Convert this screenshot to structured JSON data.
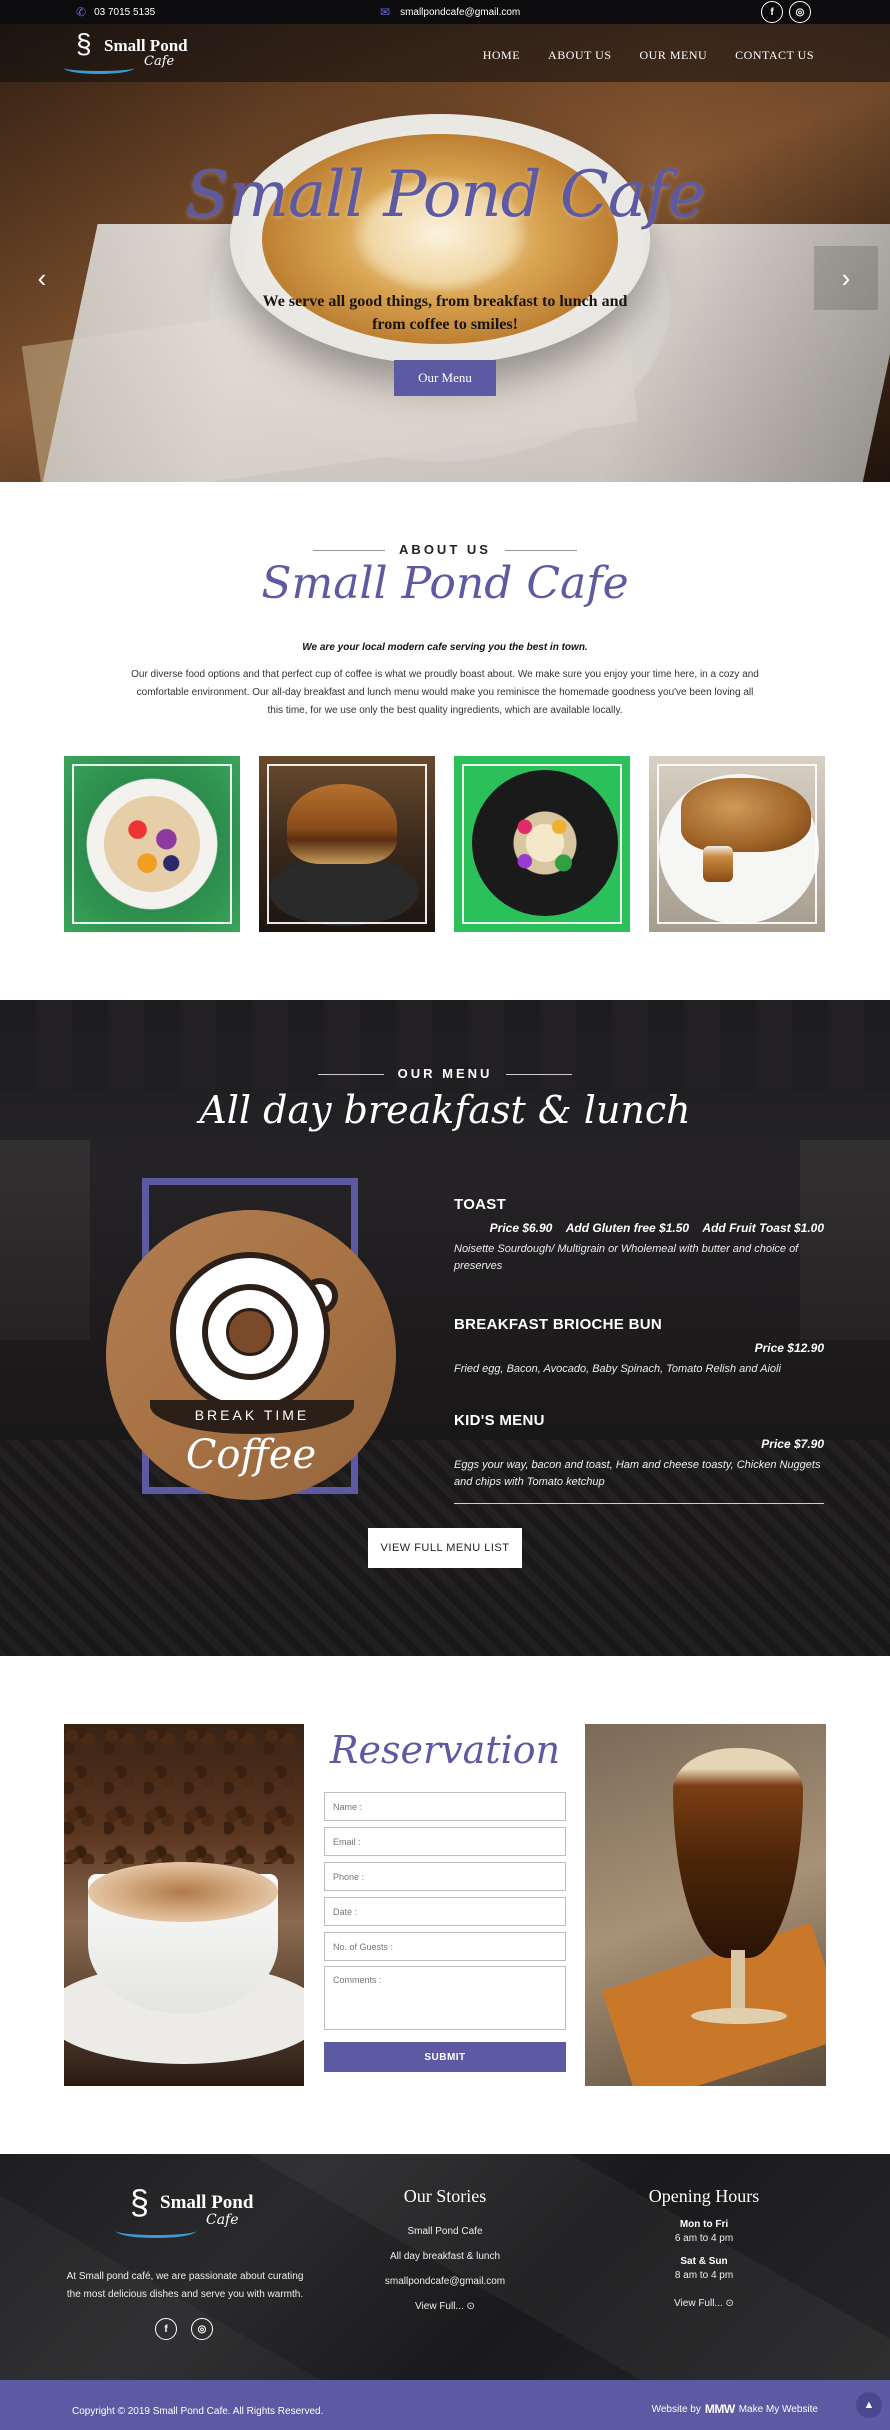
{
  "topbar": {
    "phone": "03 7015 5135",
    "email": "smallpondcafe@gmail.com",
    "social": {
      "facebook": "f",
      "instagram": "◎"
    }
  },
  "header": {
    "logo_name": "Small Pond",
    "logo_cafe": "Cafe",
    "nav": [
      "HOME",
      "ABOUT US",
      "OUR MENU",
      "CONTACT US"
    ]
  },
  "hero": {
    "title": "Small Pond Cafe",
    "subtitle_line1": "We serve all good things, from breakfast to lunch and",
    "subtitle_line2": "from coffee to smiles!",
    "button": "Our Menu",
    "prev": "‹",
    "next": "›"
  },
  "about": {
    "label": "ABOUT US",
    "title": "Small Pond Cafe",
    "tagline": "We are your local modern cafe serving you the best in town.",
    "body": "Our diverse food options and that perfect cup of coffee is what we proudly boast about. We make sure you enjoy your time here, in a cozy and comfortable environment. Our all-day breakfast and lunch menu would make you reminisce the homemade goodness you've been loving all this time, for we use only the best quality ingredients, which are available locally."
  },
  "menu": {
    "label": "OUR MENU",
    "title": "All day breakfast & lunch",
    "badge_text": "BREAK TIME",
    "badge_word": "Coffee",
    "items": [
      {
        "name": "TOAST",
        "prices": [
          "Price   $6.90",
          "Add Gluten free   $1.50",
          "Add Fruit Toast   $1.00"
        ],
        "desc": "Noisette Sourdough/ Multigrain or Wholemeal with butter and choice of preserves"
      },
      {
        "name": "BREAKFAST BRIOCHE BUN",
        "prices": [
          "Price   $12.90"
        ],
        "desc": "Fried egg, Bacon, Avocado, Baby Spinach, Tomato Relish and Aioli"
      },
      {
        "name": "KID'S MENU",
        "prices": [
          "Price   $7.90"
        ],
        "desc": "Eggs your way, bacon and toast, Ham and cheese toasty, Chicken Nuggets and chips with Tomato ketchup"
      }
    ],
    "button": "VIEW FULL MENU LIST"
  },
  "reservation": {
    "title": "Reservation",
    "fields": {
      "name": "Name :",
      "email": "Email :",
      "phone": "Phone :",
      "date": "Date :",
      "guests": "No. of Guests :",
      "comments": "Comments :"
    },
    "submit": "SUBMIT"
  },
  "footer": {
    "logo_name": "Small Pond",
    "logo_cafe": "Cafe",
    "desc": "At Small pond café, we are passionate about curating the most delicious dishes and serve you with warmth.",
    "stories": {
      "heading": "Our Stories",
      "links": [
        "Small Pond Cafe",
        "All day breakfast & lunch",
        "smallpondcafe@gmail.com",
        "View Full... ⊙"
      ]
    },
    "hours": {
      "heading": "Opening Hours",
      "d1": "Mon to Fri",
      "t1": "6 am to 4 pm",
      "d2": "Sat & Sun",
      "t2": "8 am to 4 pm",
      "more": "View Full... ⊙"
    }
  },
  "copyright": {
    "text": "Copyright © 2019 Small Pond Cafe. All Rights Reserved.",
    "website_by": "Website by",
    "brand_logo": "MMW",
    "brand": "Make My Website",
    "to_top": "▲"
  },
  "colors": {
    "accent": "#5b5aa2",
    "dark": "#1b1a1d",
    "swoosh": "#3d9ad6"
  }
}
